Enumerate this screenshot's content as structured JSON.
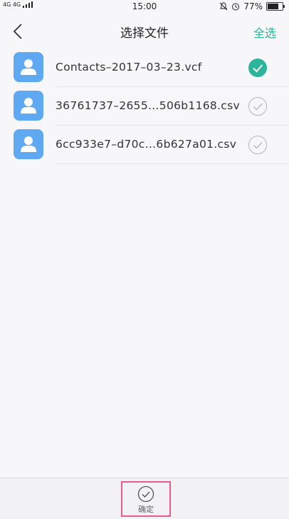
{
  "status_bar": {
    "network": "4G 4G",
    "time": "15:00",
    "battery_percent": "77%",
    "battery_level": 0.77,
    "icons": [
      "mute-icon",
      "alarm-icon",
      "battery-icon"
    ]
  },
  "header": {
    "title": "选择文件",
    "select_all_label": "全选",
    "back_icon": "chevron-left-icon"
  },
  "files": [
    {
      "name": "Contacts–2017–03–23.vcf",
      "selected": true
    },
    {
      "name": "36761737–2655…506b1168.csv",
      "selected": false
    },
    {
      "name": "6cc933e7–d70c…6b627a01.csv",
      "selected": false
    }
  ],
  "footer": {
    "confirm_label": "确定",
    "confirm_icon": "check-circle-icon"
  },
  "colors": {
    "accent": "#2bb59a",
    "avatar": "#5ea9f2",
    "highlight": "#e85b8f"
  }
}
